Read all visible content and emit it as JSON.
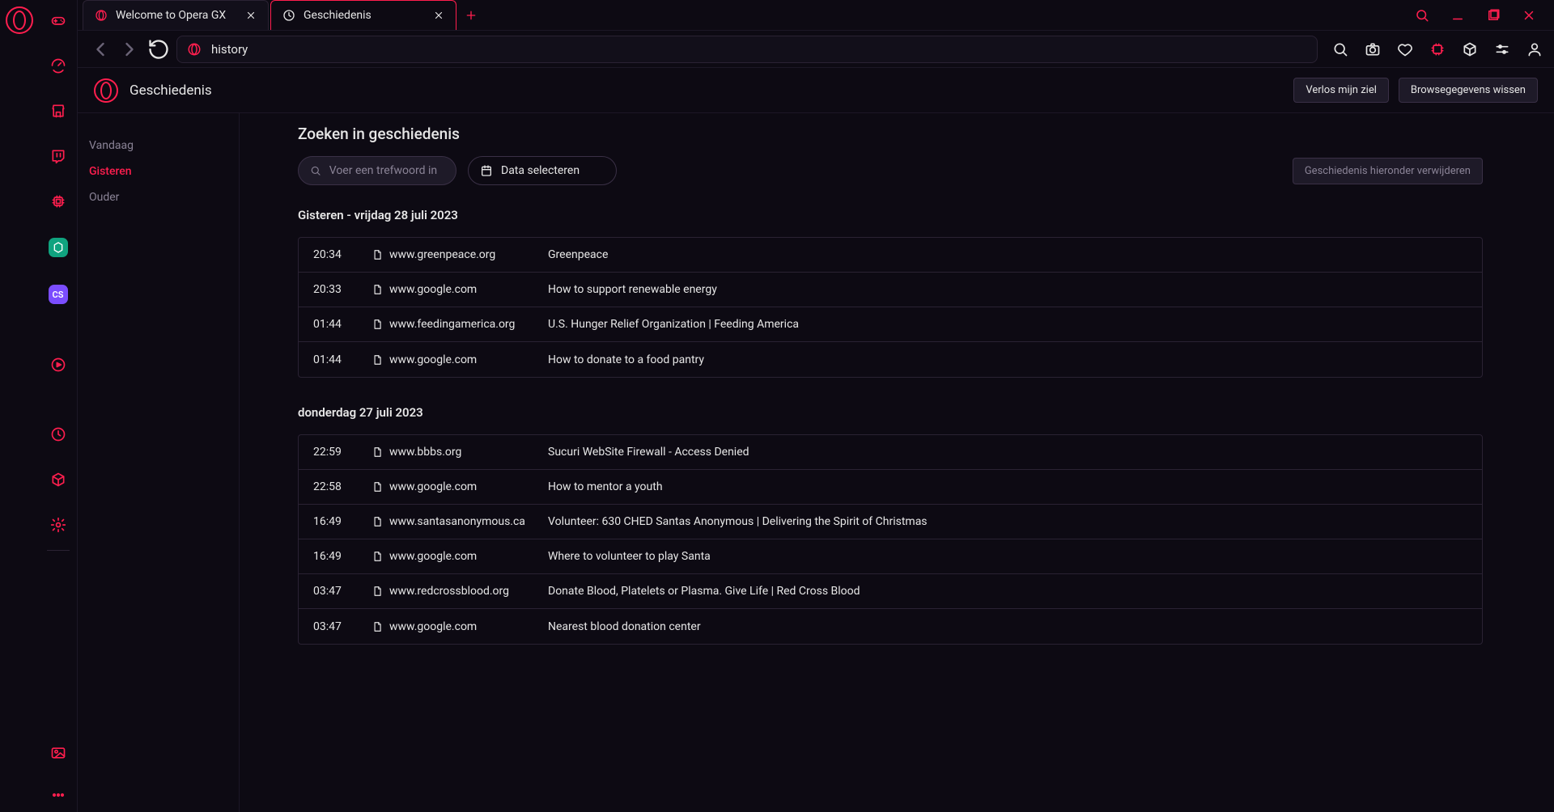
{
  "tabs": [
    {
      "title": "Welcome to Opera GX",
      "active": false,
      "icon": "opera"
    },
    {
      "title": "Geschiedenis",
      "active": true,
      "icon": "clock"
    }
  ],
  "address": {
    "url": "history"
  },
  "page": {
    "title": "Geschiedenis",
    "buttons": {
      "clearSoul": "Verlos mijn ziel",
      "clearData": "Browsegegevens wissen"
    },
    "searchHeader": "Zoeken in geschiedenis",
    "searchPlaceholder": "Voer een trefwoord in",
    "dateSelect": "Data selecteren",
    "deleteBelow": "Geschiedenis hieronder verwijderen"
  },
  "nav": {
    "items": [
      {
        "label": "Vandaag",
        "active": false
      },
      {
        "label": "Gisteren",
        "active": true
      },
      {
        "label": "Ouder",
        "active": false
      }
    ]
  },
  "days": [
    {
      "label": "Gisteren - vrijdag 28 juli 2023",
      "rows": [
        {
          "time": "20:34",
          "domain": "www.greenpeace.org",
          "title": "Greenpeace"
        },
        {
          "time": "20:33",
          "domain": "www.google.com",
          "title": "How to support renewable energy"
        },
        {
          "time": "01:44",
          "domain": "www.feedingamerica.org",
          "title": "U.S. Hunger Relief Organization | Feeding America"
        },
        {
          "time": "01:44",
          "domain": "www.google.com",
          "title": "How to donate to a food pantry"
        }
      ]
    },
    {
      "label": "donderdag 27 juli 2023",
      "rows": [
        {
          "time": "22:59",
          "domain": "www.bbbs.org",
          "title": "Sucuri WebSite Firewall - Access Denied"
        },
        {
          "time": "22:58",
          "domain": "www.google.com",
          "title": "How to mentor a youth"
        },
        {
          "time": "16:49",
          "domain": "www.santasanonymous.ca",
          "title": "Volunteer: 630 CHED Santas Anonymous | Delivering the Spirit of Christmas"
        },
        {
          "time": "16:49",
          "domain": "www.google.com",
          "title": "Where to volunteer to play Santa"
        },
        {
          "time": "03:47",
          "domain": "www.redcrossblood.org",
          "title": "Donate Blood, Platelets or Plasma. Give Life | Red Cross Blood"
        },
        {
          "time": "03:47",
          "domain": "www.google.com",
          "title": "Nearest blood donation center"
        }
      ]
    }
  ],
  "colors": {
    "accent": "#ff1e4e",
    "bg": "#0d0a13"
  }
}
